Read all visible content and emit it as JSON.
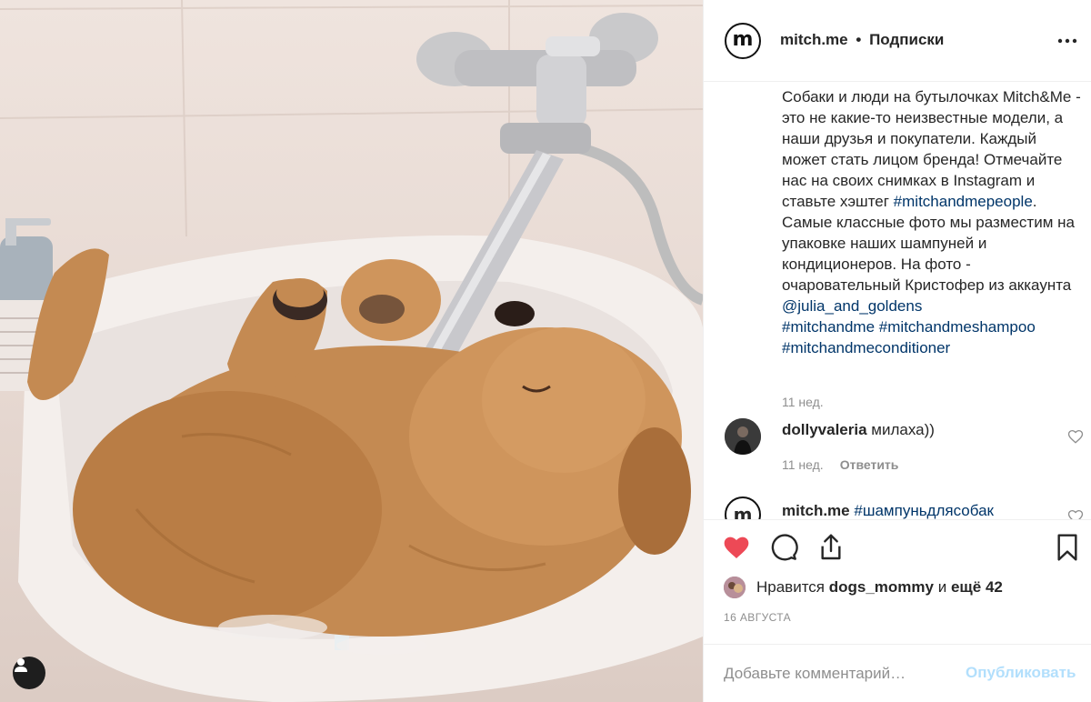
{
  "post": {
    "account": "mitch.me",
    "separator": "•",
    "follow_status": "Подписки",
    "logo_letter": "m"
  },
  "caption": {
    "part1": "Собаки и люди на бутылочках Mitch&Me - это не какие-то неизвестные модели, а наши друзья и покупатели. Каждый может стать лицом бренда! Отмечайте нас на своих снимках в Instagram и ставьте хэштег ",
    "hashtag1": "#mitchandmepeople",
    "part2": ". Самые классные фото мы разместим на упаковке наших шампуней и кондиционеров. На фото - очаровательный Кристофер из аккаунта ",
    "mention": "@julia_and_goldens",
    "hashtag2": "#mitchandme",
    "hashtag3": "#mitchandmeshampoo",
    "hashtag4": "#mitchandmeconditioner",
    "time": "11 нед."
  },
  "comments": [
    {
      "user": "dollyvaleria",
      "text": "милаха))",
      "time": "11 нед.",
      "reply": "Ответить"
    },
    {
      "user": "mitch.me",
      "text": "#шампуньдлясобак"
    }
  ],
  "likes": {
    "prefix": "Нравится",
    "user": "dogs_mommy",
    "conj": "и",
    "rest": "ещё 42"
  },
  "date": "16 АВГУСТА",
  "add_comment": {
    "placeholder": "Добавьте комментарий…",
    "publish": "Опубликовать"
  },
  "colors": {
    "like_red": "#ed4956",
    "link_blue": "#003569",
    "publish_disabled": "#b2dffc",
    "muted": "#8e8e8e"
  }
}
